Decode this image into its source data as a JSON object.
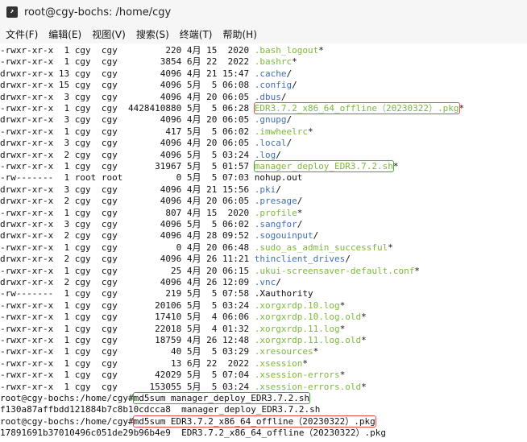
{
  "window": {
    "title": "root@cgy-bochs: /home/cgy"
  },
  "menu": [
    {
      "label": "文件(F)"
    },
    {
      "label": "编辑(E)"
    },
    {
      "label": "视图(V)"
    },
    {
      "label": "搜索(S)"
    },
    {
      "label": "终端(T)"
    },
    {
      "label": "帮助(H)"
    }
  ],
  "colors": {
    "hidden_green": "#7db839",
    "dir_blue": "#3f6fb5",
    "highlight_red": "#e64b4b",
    "highlight_green": "#4aa53d"
  },
  "terminal": {
    "lines": [
      {
        "perm": "-rwxr-xr-x",
        "links": " 1",
        "owner": "cgy",
        "group": "cgy",
        "size": "220",
        "month": "4月",
        "day": "15",
        "time": " 2020",
        "name": ".bash_logout",
        "suffix": "*",
        "type": "exec"
      },
      {
        "perm": "-rwxr-xr-x",
        "links": " 1",
        "owner": "cgy",
        "group": "cgy",
        "size": "3854",
        "month": "6月",
        "day": "22",
        "time": " 2022",
        "name": ".bashrc",
        "suffix": "*",
        "type": "exec"
      },
      {
        "perm": "drwxr-xr-x",
        "links": "13",
        "owner": "cgy",
        "group": "cgy",
        "size": "4096",
        "month": "4月",
        "day": "21",
        "time": "15:47",
        "name": ".cache",
        "suffix": "/",
        "type": "dir"
      },
      {
        "perm": "drwxr-xr-x",
        "links": "15",
        "owner": "cgy",
        "group": "cgy",
        "size": "4096",
        "month": "5月",
        "day": " 5",
        "time": "06:08",
        "name": ".config",
        "suffix": "/",
        "type": "dir"
      },
      {
        "perm": "drwxr-xr-x",
        "links": " 3",
        "owner": "cgy",
        "group": "cgy",
        "size": "4096",
        "month": "4月",
        "day": "20",
        "time": "06:05",
        "name": ".dbus",
        "suffix": "/",
        "type": "dir"
      },
      {
        "perm": "-rwxr-xr-x",
        "links": " 1",
        "owner": "cgy",
        "group": "cgy",
        "size": "4428410880",
        "month": "5月",
        "day": " 5",
        "time": "06:28",
        "name": "EDR3.7.2_x86_64_offline（20230322）.pkg",
        "suffix": "*",
        "type": "exec",
        "highlight": "red"
      },
      {
        "perm": "drwxr-xr-x",
        "links": " 3",
        "owner": "cgy",
        "group": "cgy",
        "size": "4096",
        "month": "4月",
        "day": "20",
        "time": "06:05",
        "name": ".gnupg",
        "suffix": "/",
        "type": "dir"
      },
      {
        "perm": "-rwxr-xr-x",
        "links": " 1",
        "owner": "cgy",
        "group": "cgy",
        "size": "417",
        "month": "5月",
        "day": " 5",
        "time": "06:02",
        "name": ".imwheelrc",
        "suffix": "*",
        "type": "exec"
      },
      {
        "perm": "drwxr-xr-x",
        "links": " 3",
        "owner": "cgy",
        "group": "cgy",
        "size": "4096",
        "month": "4月",
        "day": "20",
        "time": "06:05",
        "name": ".local",
        "suffix": "/",
        "type": "dir"
      },
      {
        "perm": "drwxr-xr-x",
        "links": " 2",
        "owner": "cgy",
        "group": "cgy",
        "size": "4096",
        "month": "5月",
        "day": " 5",
        "time": "03:24",
        "name": ".log",
        "suffix": "/",
        "type": "dir"
      },
      {
        "perm": "-rwxr-xr-x",
        "links": " 1",
        "owner": "cgy",
        "group": "cgy",
        "size": "31967",
        "month": "5月",
        "day": " 5",
        "time": "01:57",
        "name": "manager_deploy_EDR3.7.2.sh",
        "suffix": "*",
        "type": "exec",
        "highlight": "green"
      },
      {
        "perm": "-rw-------",
        "links": " 1",
        "owner": "root",
        "group": "root",
        "size": "0",
        "month": "5月",
        "day": " 5",
        "time": "07:03",
        "name": "nohup.out",
        "suffix": "",
        "type": "plain"
      },
      {
        "perm": "drwxr-xr-x",
        "links": " 3",
        "owner": "cgy",
        "group": "cgy",
        "size": "4096",
        "month": "4月",
        "day": "21",
        "time": "15:56",
        "name": ".pki",
        "suffix": "/",
        "type": "dir"
      },
      {
        "perm": "drwxr-xr-x",
        "links": " 2",
        "owner": "cgy",
        "group": "cgy",
        "size": "4096",
        "month": "4月",
        "day": "20",
        "time": "06:05",
        "name": ".presage",
        "suffix": "/",
        "type": "dir"
      },
      {
        "perm": "-rwxr-xr-x",
        "links": " 1",
        "owner": "cgy",
        "group": "cgy",
        "size": "807",
        "month": "4月",
        "day": "15",
        "time": " 2020",
        "name": ".profile",
        "suffix": "*",
        "type": "exec"
      },
      {
        "perm": "drwxr-xr-x",
        "links": " 3",
        "owner": "cgy",
        "group": "cgy",
        "size": "4096",
        "month": "5月",
        "day": " 5",
        "time": "06:02",
        "name": ".sangfor",
        "suffix": "/",
        "type": "dir"
      },
      {
        "perm": "drwxr-xr-x",
        "links": " 2",
        "owner": "cgy",
        "group": "cgy",
        "size": "4096",
        "month": "4月",
        "day": "28",
        "time": "09:52",
        "name": ".sogouinput",
        "suffix": "/",
        "type": "dir"
      },
      {
        "perm": "-rwxr-xr-x",
        "links": " 1",
        "owner": "cgy",
        "group": "cgy",
        "size": "0",
        "month": "4月",
        "day": "20",
        "time": "06:48",
        "name": ".sudo_as_admin_successful",
        "suffix": "*",
        "type": "exec"
      },
      {
        "perm": "drwxr-xr-x",
        "links": " 2",
        "owner": "cgy",
        "group": "cgy",
        "size": "4096",
        "month": "4月",
        "day": "26",
        "time": "11:21",
        "name": "thinclient_drives",
        "suffix": "/",
        "type": "dir"
      },
      {
        "perm": "-rwxr-xr-x",
        "links": " 1",
        "owner": "cgy",
        "group": "cgy",
        "size": "25",
        "month": "4月",
        "day": "20",
        "time": "06:15",
        "name": ".ukui-screensaver-default.conf",
        "suffix": "*",
        "type": "exec"
      },
      {
        "perm": "drwxr-xr-x",
        "links": " 2",
        "owner": "cgy",
        "group": "cgy",
        "size": "4096",
        "month": "4月",
        "day": "26",
        "time": "12:09",
        "name": ".vnc",
        "suffix": "/",
        "type": "dir"
      },
      {
        "perm": "-rw-------",
        "links": " 1",
        "owner": "cgy",
        "group": "cgy",
        "size": "219",
        "month": "5月",
        "day": " 5",
        "time": "07:58",
        "name": ".Xauthority",
        "suffix": "",
        "type": "plain"
      },
      {
        "perm": "-rwxr-xr-x",
        "links": " 1",
        "owner": "cgy",
        "group": "cgy",
        "size": "20106",
        "month": "5月",
        "day": " 5",
        "time": "03:24",
        "name": ".xorgxrdp.10.log",
        "suffix": "*",
        "type": "exec"
      },
      {
        "perm": "-rwxr-xr-x",
        "links": " 1",
        "owner": "cgy",
        "group": "cgy",
        "size": "17410",
        "month": "5月",
        "day": " 4",
        "time": "06:06",
        "name": ".xorgxrdp.10.log.old",
        "suffix": "*",
        "type": "exec"
      },
      {
        "perm": "-rwxr-xr-x",
        "links": " 1",
        "owner": "cgy",
        "group": "cgy",
        "size": "22018",
        "month": "5月",
        "day": " 4",
        "time": "01:32",
        "name": ".xorgxrdp.11.log",
        "suffix": "*",
        "type": "exec"
      },
      {
        "perm": "-rwxr-xr-x",
        "links": " 1",
        "owner": "cgy",
        "group": "cgy",
        "size": "18759",
        "month": "4月",
        "day": "26",
        "time": "12:48",
        "name": ".xorgxrdp.11.log.old",
        "suffix": "*",
        "type": "exec"
      },
      {
        "perm": "-rwxr-xr-x",
        "links": " 1",
        "owner": "cgy",
        "group": "cgy",
        "size": "40",
        "month": "5月",
        "day": " 5",
        "time": "03:29",
        "name": ".xresources",
        "suffix": "*",
        "type": "exec"
      },
      {
        "perm": "-rwxr-xr-x",
        "links": " 1",
        "owner": "cgy",
        "group": "cgy",
        "size": "13",
        "month": "6月",
        "day": "22",
        "time": " 2022",
        "name": ".xsession",
        "suffix": "*",
        "type": "exec"
      },
      {
        "perm": "-rwxr-xr-x",
        "links": " 1",
        "owner": "cgy",
        "group": "cgy",
        "size": "42029",
        "month": "5月",
        "day": " 5",
        "time": "07:04",
        "name": ".xsession-errors",
        "suffix": "*",
        "type": "exec"
      },
      {
        "perm": "-rwxr-xr-x",
        "links": " 1",
        "owner": "cgy",
        "group": "cgy",
        "size": "153055",
        "month": "5月",
        "day": " 5",
        "time": "03:24",
        "name": ".xsession-errors.old",
        "suffix": "*",
        "type": "exec"
      }
    ],
    "commands": [
      {
        "prompt": "root@cgy-bochs:/home/cgy#",
        "cmd": "md5sum manager_deploy_EDR3.7.2.sh",
        "highlight": "green"
      },
      {
        "output": "f130a87affbdd121884b7c8b10cdcca8  manager_deploy_EDR3.7.2.sh"
      },
      {
        "prompt": "root@cgy-bochs:/home/cgy#",
        "cmd": "md5sum EDR3.7.2_x86_64_offline（20230322）.pkg",
        "highlight": "red"
      },
      {
        "output": "17891691b37010496c051de29b96b4e9  EDR3.7.2_x86_64_offline（20230322）.pkg"
      }
    ]
  }
}
